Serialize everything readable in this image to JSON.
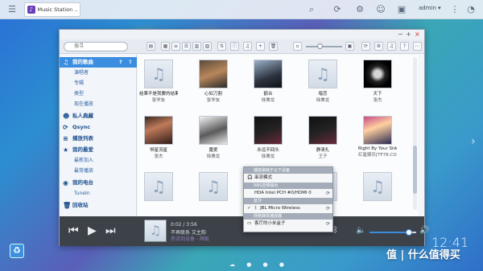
{
  "topbar": {
    "app_tab_title": "Music Station ...",
    "user": "admin ▾"
  },
  "window": {
    "search_placeholder": "搜寻"
  },
  "sidebar": {
    "items": [
      {
        "label": "我的歌曲",
        "icon": "music-note-icon",
        "type": "header"
      },
      {
        "label": "演唱者",
        "type": "item"
      },
      {
        "label": "专辑",
        "type": "item"
      },
      {
        "label": "类型",
        "type": "item"
      },
      {
        "label": "现在播放",
        "type": "item"
      },
      {
        "label": "私人典藏",
        "icon": "person-icon",
        "type": "header"
      },
      {
        "label": "Qsync",
        "icon": "sync-icon",
        "type": "header"
      },
      {
        "label": "播放列表",
        "icon": "playlist-icon",
        "type": "header"
      },
      {
        "label": "我的最爱",
        "icon": "star-icon",
        "type": "header"
      },
      {
        "label": "最新加入",
        "type": "item"
      },
      {
        "label": "最常播放",
        "type": "item"
      },
      {
        "label": "我的电台",
        "icon": "radio-icon",
        "type": "header"
      },
      {
        "label": "TuneIn",
        "type": "item"
      },
      {
        "label": "回收站",
        "icon": "trash-icon",
        "type": "header"
      }
    ]
  },
  "albums": [
    {
      "title": "结果不是我要的结果",
      "artist": "张学友",
      "art": "note"
    },
    {
      "title": "心如刀割",
      "artist": "张学友",
      "art": "art1"
    },
    {
      "title": "鹤合",
      "artist": "徐秉龙",
      "art": "art2"
    },
    {
      "title": "暗恋",
      "artist": "徐秉龙",
      "art": "note"
    },
    {
      "title": "天下",
      "artist": "张杰",
      "art": "art3"
    },
    {
      "title": "恒星流星",
      "artist": "张杰",
      "art": "art4"
    },
    {
      "title": "魔爱",
      "artist": "徐秉龙",
      "art": "art5"
    },
    {
      "title": "永远不回头",
      "artist": "徐秉龙",
      "art": "art6"
    },
    {
      "title": "静清扎",
      "artist": "王子",
      "art": "art6"
    },
    {
      "title": "Right By Your Side",
      "artist": "红星娱乐[TF78.CO...",
      "art": "art7"
    },
    {
      "title": "",
      "artist": "",
      "art": "note"
    },
    {
      "title": "",
      "artist": "",
      "art": "note"
    },
    {
      "title": "",
      "artist": "",
      "art": "note"
    },
    {
      "title": "",
      "artist": "",
      "art": "note"
    },
    {
      "title": "",
      "artist": "",
      "art": "note"
    }
  ],
  "player": {
    "time": "0:02 / 3:56",
    "track": "不再联系 文主韵",
    "device": "串流到设备 - 隔板",
    "volume_percent": 85
  },
  "popup": {
    "header": "播放歌曲于以下设备",
    "rows": [
      {
        "kind": "row",
        "label": "串流模式",
        "mark": "headphone-icon"
      },
      {
        "kind": "head",
        "label": "NAS音频输出"
      },
      {
        "kind": "row",
        "label": "HDA Intel PCH #0/HDMI 0",
        "mark": ""
      },
      {
        "kind": "head",
        "label": "蓝牙"
      },
      {
        "kind": "row",
        "label": "JBL Micro Wireless",
        "mark": "check-icon"
      },
      {
        "kind": "head",
        "label": "网络媒体播放器"
      },
      {
        "kind": "row",
        "label": "客厅的小米盒子",
        "mark": ""
      }
    ]
  },
  "desktop": {
    "clock": "12:41",
    "watermark": "值 | 什么值得买"
  },
  "colors": {
    "accent": "#3b8de0",
    "player_bg": "#3d4148"
  }
}
